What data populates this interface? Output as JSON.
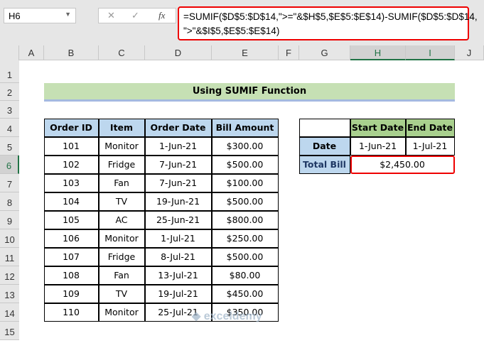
{
  "name_box": "H6",
  "formula_bar": {
    "cancel": "✕",
    "enter": "✓",
    "fx": "fx",
    "formula": "=SUMIF($D$5:$D$14,\">=\"&$H$5,$E$5:$E$14)-SUMIF($D$5:$D$14,\n\">\"&$I$5,$E$5:$E$14)"
  },
  "columns": [
    "A",
    "B",
    "C",
    "D",
    "E",
    "F",
    "G",
    "H",
    "I",
    "J"
  ],
  "rows": [
    "1",
    "2",
    "3",
    "4",
    "5",
    "6",
    "7",
    "8",
    "9",
    "10",
    "11",
    "12",
    "13",
    "14",
    "15"
  ],
  "title": "Using SUMIF Function",
  "table": {
    "headers": [
      "Order ID",
      "Item",
      "Order Date",
      "Bill Amount"
    ],
    "rows": [
      [
        "101",
        "Monitor",
        "1-Jun-21",
        "$300.00"
      ],
      [
        "102",
        "Fridge",
        "7-Jun-21",
        "$500.00"
      ],
      [
        "103",
        "Fan",
        "7-Jun-21",
        "$100.00"
      ],
      [
        "104",
        "TV",
        "19-Jun-21",
        "$500.00"
      ],
      [
        "105",
        "AC",
        "25-Jun-21",
        "$800.00"
      ],
      [
        "106",
        "Monitor",
        "1-Jul-21",
        "$250.00"
      ],
      [
        "107",
        "Fridge",
        "8-Jul-21",
        "$500.00"
      ],
      [
        "108",
        "Fan",
        "13-Jul-21",
        "$80.00"
      ],
      [
        "109",
        "TV",
        "19-Jul-21",
        "$450.00"
      ],
      [
        "110",
        "Monitor",
        "25-Jul-21",
        "$350.00"
      ]
    ]
  },
  "criteria": {
    "start_label": "Start Date",
    "end_label": "End Date",
    "date_label": "Date",
    "start": "1-Jun-21",
    "end": "1-Jul-21",
    "total_label": "Total Bill",
    "total": "$2,450.00"
  },
  "watermark": "exceldemy"
}
